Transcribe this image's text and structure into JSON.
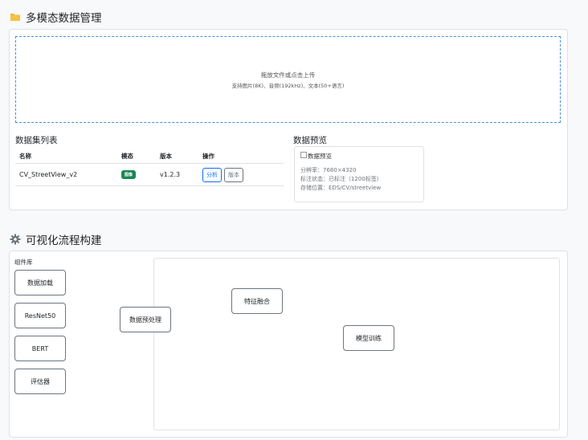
{
  "data_section": {
    "title": "多模态数据管理",
    "icon": "folder-icon",
    "upload": {
      "line1": "拖放文件或点击上传",
      "line2": "支持图片(8K)、音频(192kHz)、文本(50+语言)"
    },
    "dataset_list": {
      "heading": "数据集列表",
      "columns": [
        "名称",
        "模态",
        "版本",
        "操作"
      ],
      "rows": [
        {
          "name": "CV_StreetView_v2",
          "modality": "图像",
          "version": "v1.2.3",
          "actions": [
            "分析",
            "版本"
          ]
        }
      ]
    },
    "preview": {
      "heading": "数据预览",
      "image_alt": "数据预览",
      "resolution": "分辨率：7680×4320",
      "label_status": "标注状态：已标注（1200标签）",
      "storage": "存储位置：EDS/CV/streetview"
    }
  },
  "flow_section": {
    "title": "可视化流程构建",
    "icon": "gear-icon",
    "library_label": "组件库",
    "components": [
      "数据加载",
      "ResNet50",
      "BERT",
      "评估器"
    ],
    "nodes": [
      "数据预处理",
      "特征融合",
      "模型训练"
    ]
  },
  "colors": {
    "folder": "#f0b429",
    "gear": "#6c757d",
    "upload_border": "#4a8fd4",
    "badge": "#198754",
    "primary": "#0d6efd"
  }
}
